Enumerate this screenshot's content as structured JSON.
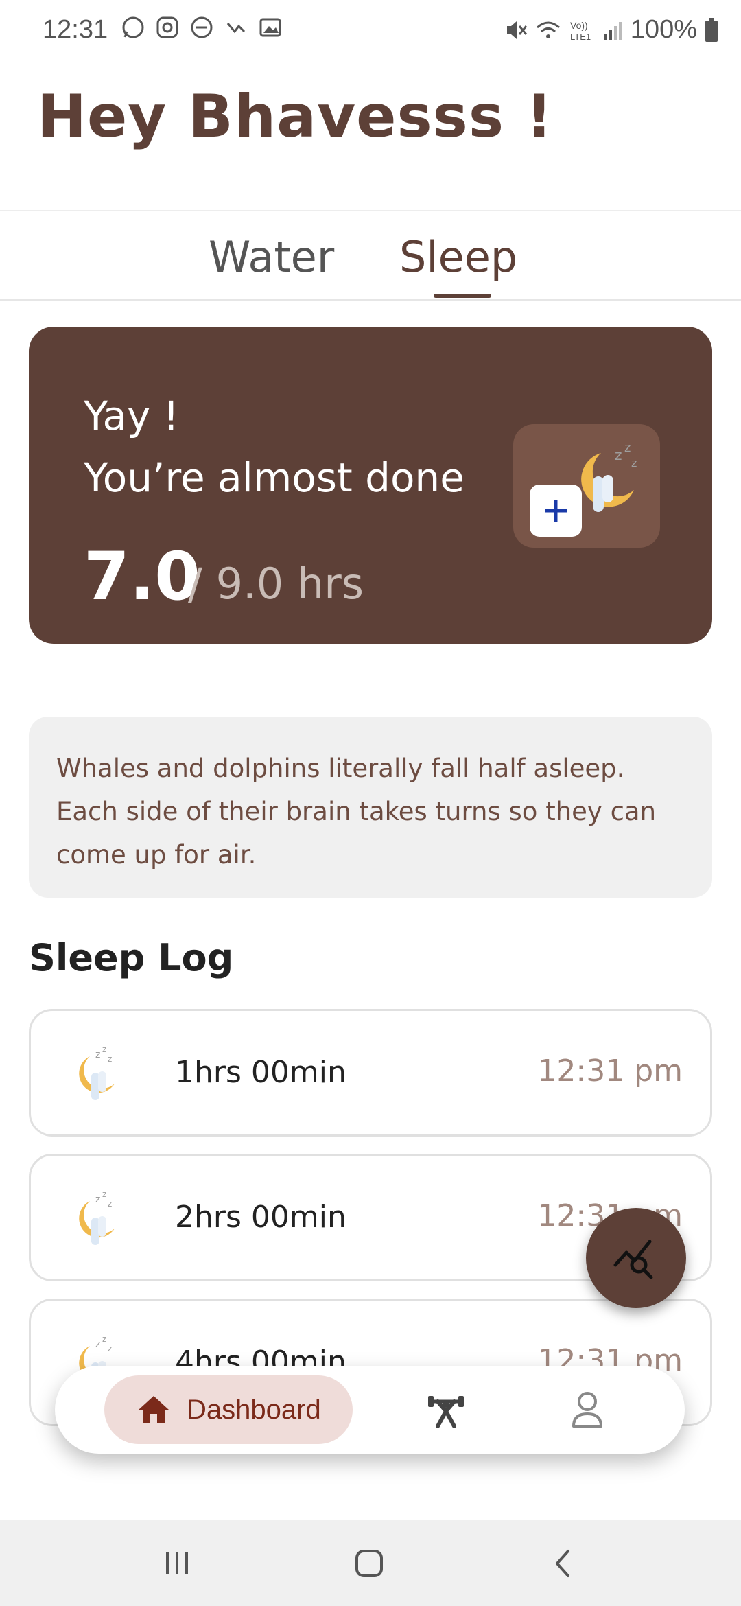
{
  "status_bar": {
    "time": "12:31",
    "battery_text": "100%",
    "left_icons": [
      "whatsapp-icon",
      "instagram-icon",
      "dnd-icon",
      "missed-call-icon",
      "gallery-icon"
    ],
    "right_icons": [
      "mute-icon",
      "wifi-icon",
      "volte-icon",
      "signal-icon",
      "battery-icon"
    ]
  },
  "header": {
    "greeting": "Hey Bhavesss !"
  },
  "tabs": [
    {
      "label": "Water",
      "selected": false
    },
    {
      "label": "Sleep",
      "selected": true
    }
  ],
  "summary": {
    "line1": "Yay !",
    "line2": "You’re almost done",
    "current": "7.0",
    "target": "/ 9.0 hrs",
    "progress_fraction": 0.778,
    "add_button_icon": "plus-icon"
  },
  "fact": {
    "text": "Whales and dolphins literally fall half asleep. Each side of their brain takes turns so they can come up for air."
  },
  "sleep_log": {
    "title": "Sleep Log",
    "entries": [
      {
        "duration": "1hrs 00min",
        "time": "12:31 pm"
      },
      {
        "duration": "2hrs 00min",
        "time": "12:31 pm"
      },
      {
        "duration": "4hrs 00min",
        "time": "12:31 pm"
      }
    ]
  },
  "bottom_nav": {
    "items": [
      {
        "label": "Dashboard",
        "icon": "home-icon",
        "selected": true
      },
      {
        "label": "",
        "icon": "workout-icon",
        "selected": false
      },
      {
        "label": "",
        "icon": "profile-icon",
        "selected": false
      }
    ]
  },
  "colors": {
    "brand": "#5d4037",
    "card_tile": "#795548",
    "nav_selected_bg": "#efdcd9",
    "nav_selected_text": "#7b2a1a",
    "log_time": "#a1887f"
  }
}
